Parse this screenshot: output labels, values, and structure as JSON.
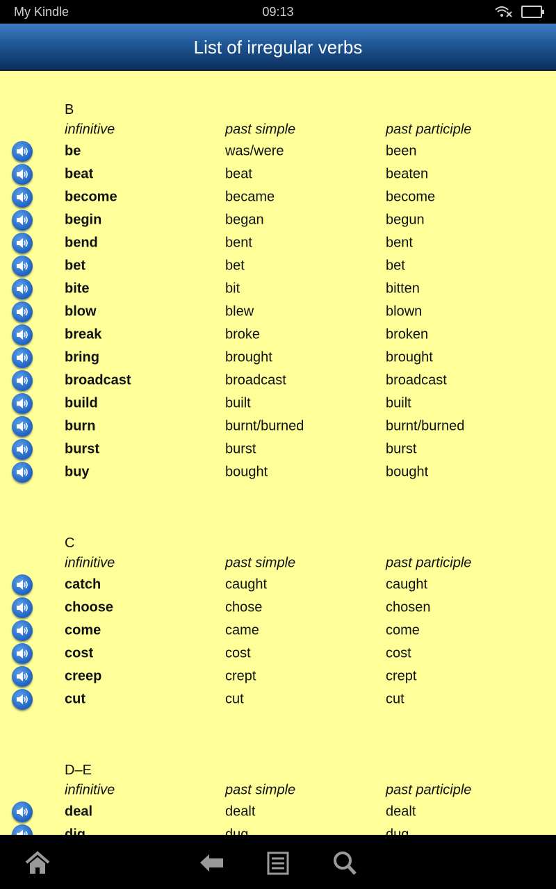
{
  "status_bar": {
    "label": "My Kindle",
    "time": "09:13",
    "icons": [
      "wifi-off-icon",
      "battery-charging-icon"
    ]
  },
  "header": {
    "title": "List of irregular verbs"
  },
  "columns": {
    "infinitive": "infinitive",
    "past_simple": "past simple",
    "past_participle": "past participle"
  },
  "sections": [
    {
      "letter": "B",
      "verbs": [
        [
          "be",
          "was/were",
          "been"
        ],
        [
          "beat",
          "beat",
          "beaten"
        ],
        [
          "become",
          "became",
          "become"
        ],
        [
          "begin",
          "began",
          "begun"
        ],
        [
          "bend",
          "bent",
          "bent"
        ],
        [
          "bet",
          "bet",
          "bet"
        ],
        [
          "bite",
          "bit",
          "bitten"
        ],
        [
          "blow",
          "blew",
          "blown"
        ],
        [
          "break",
          "broke",
          "broken"
        ],
        [
          "bring",
          "brought",
          "brought"
        ],
        [
          "broadcast",
          "broadcast",
          "broadcast"
        ],
        [
          "build",
          "built",
          "built"
        ],
        [
          "burn",
          "burnt/burned",
          "burnt/burned"
        ],
        [
          "burst",
          "burst",
          "burst"
        ],
        [
          "buy",
          "bought",
          "bought"
        ]
      ]
    },
    {
      "letter": "C",
      "verbs": [
        [
          "catch",
          "caught",
          "caught"
        ],
        [
          "choose",
          "chose",
          "chosen"
        ],
        [
          "come",
          "came",
          "come"
        ],
        [
          "cost",
          "cost",
          "cost"
        ],
        [
          "creep",
          "crept",
          "crept"
        ],
        [
          "cut",
          "cut",
          "cut"
        ]
      ]
    },
    {
      "letter": "D–E",
      "verbs": [
        [
          "deal",
          "dealt",
          "dealt"
        ],
        [
          "dig",
          "dug",
          "dug"
        ]
      ]
    }
  ],
  "colors": {
    "background": "#ffff99",
    "header": "#1f5795",
    "speaker": "#1f62c0"
  },
  "nav": [
    "home-icon",
    "back-icon",
    "menu-icon",
    "search-icon"
  ]
}
